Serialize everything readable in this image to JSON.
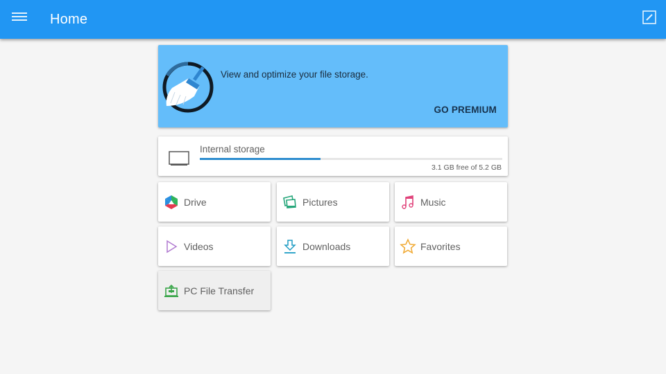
{
  "appbar": {
    "title": "Home",
    "menu_icon": "hamburger-menu-icon",
    "edit_icon": "edit-icon",
    "color": "#2196f3"
  },
  "promo": {
    "icon": "broom-cleaner-icon",
    "text": "View and optimize your file storage.",
    "button_label": "GO PREMIUM",
    "color": "#64bdfa"
  },
  "storage": {
    "icon": "monitor-icon",
    "label": "Internal storage",
    "info": "3.1 GB free of 5.2 GB",
    "used_fraction": 0.4,
    "bar_color": "#2b8ccf"
  },
  "tiles": [
    {
      "label": "Drive",
      "icon": "drive-icon",
      "selected": false
    },
    {
      "label": "Pictures",
      "icon": "pictures-icon",
      "color": "#26a67a",
      "selected": false
    },
    {
      "label": "Music",
      "icon": "music-note-icon",
      "color": "#e0427a",
      "selected": false
    },
    {
      "label": "Videos",
      "icon": "play-icon",
      "color": "#b07ad0",
      "selected": false
    },
    {
      "label": "Downloads",
      "icon": "download-icon",
      "color": "#1e9cc4",
      "selected": false
    },
    {
      "label": "Favorites",
      "icon": "star-icon",
      "color": "#f0a830",
      "selected": false
    },
    {
      "label": "PC File Transfer",
      "icon": "pc-transfer-icon",
      "color": "#3aa64a",
      "selected": true
    }
  ]
}
